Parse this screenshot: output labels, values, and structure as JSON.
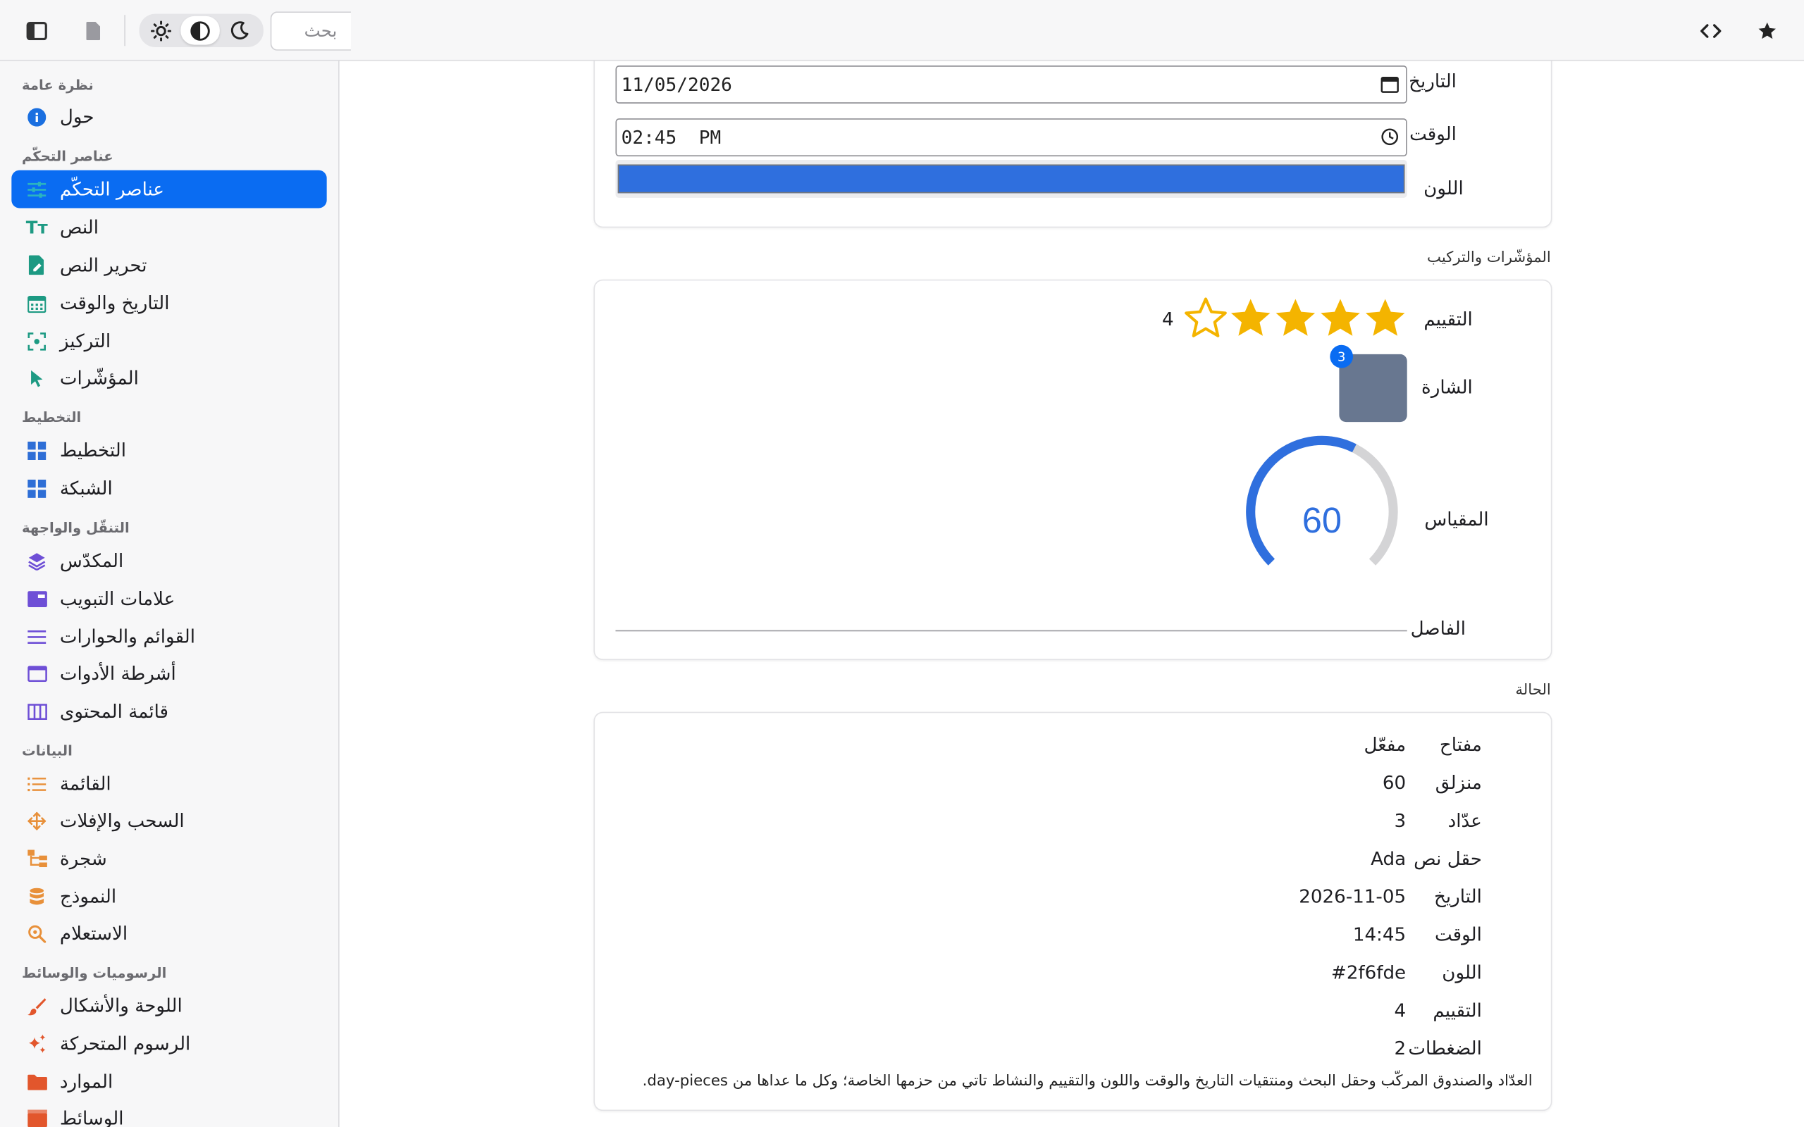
{
  "toolbar": {
    "search_placeholder": "بحث",
    "theme_options": [
      "light",
      "system",
      "dark"
    ],
    "selected_theme": "system"
  },
  "sidebar": {
    "sections": [
      {
        "title": "نظرة عامة",
        "items": [
          {
            "label": "حول",
            "icon": "info-icon"
          }
        ]
      },
      {
        "title": "عناصر التحكّم",
        "items": [
          {
            "label": "عناصر التحكّم",
            "icon": "sliders-icon",
            "active": true
          },
          {
            "label": "النص",
            "icon": "text-icon"
          },
          {
            "label": "تحرير النص",
            "icon": "edit-doc-icon"
          },
          {
            "label": "التاريخ والوقت",
            "icon": "calendar-icon"
          },
          {
            "label": "التركيز",
            "icon": "focus-icon"
          },
          {
            "label": "المؤشّرات",
            "icon": "cursor-icon"
          }
        ]
      },
      {
        "title": "التخطيط",
        "items": [
          {
            "label": "التخطيط",
            "icon": "layout-icon"
          },
          {
            "label": "الشبكة",
            "icon": "grid-icon"
          }
        ]
      },
      {
        "title": "التنقّل والواجهة",
        "items": [
          {
            "label": "المكدّس",
            "icon": "stack-icon"
          },
          {
            "label": "علامات التبويب",
            "icon": "tabs-icon"
          },
          {
            "label": "القوائم والحوارات",
            "icon": "menu-icon"
          },
          {
            "label": "أشرطة الأدوات",
            "icon": "toolbar-icon"
          },
          {
            "label": "قائمة المحتوى",
            "icon": "columns-icon"
          }
        ]
      },
      {
        "title": "البيانات",
        "items": [
          {
            "label": "القائمة",
            "icon": "list-icon"
          },
          {
            "label": "السحب والإفلات",
            "icon": "move-icon"
          },
          {
            "label": "شجرة",
            "icon": "tree-icon"
          },
          {
            "label": "النموذج",
            "icon": "database-icon"
          },
          {
            "label": "الاستعلام",
            "icon": "query-icon"
          }
        ]
      },
      {
        "title": "الرسوميات والوسائط",
        "items": [
          {
            "label": "اللوحة والأشكال",
            "icon": "brush-icon"
          },
          {
            "label": "الرسوم المتحركة",
            "icon": "sparkle-icon"
          },
          {
            "label": "الموارد",
            "icon": "folder-icon"
          },
          {
            "label": "الوسائط",
            "icon": "film-icon"
          }
        ]
      }
    ]
  },
  "inputs_card": {
    "date_label": "التاريخ",
    "date_value": "11/05/2026",
    "time_label": "الوقت",
    "time_value": "02:45  PM",
    "color_label": "اللون",
    "color_value": "#2f6fde"
  },
  "indicators": {
    "group_title": "المؤشّرات والتركيب",
    "rating_label": "التقييم",
    "rating_value": 4,
    "rating_max": 5,
    "rating_text": "4",
    "badge_label": "الشارة",
    "badge_count": "3",
    "gauge_label": "المقياس",
    "gauge_value": 60,
    "gauge_text": "60",
    "divider_label": "الفاصل"
  },
  "status": {
    "group_title": "الحالة",
    "rows": [
      {
        "label": "مفتاح",
        "value": "مفعّل"
      },
      {
        "label": "منزلق",
        "value": "60"
      },
      {
        "label": "عدّاد",
        "value": "3"
      },
      {
        "label": "حقل نص",
        "value": "Ada"
      },
      {
        "label": "التاريخ",
        "value": "2026-11-05"
      },
      {
        "label": "الوقت",
        "value": "14:45"
      },
      {
        "label": "اللون",
        "value": "#2f6fde"
      },
      {
        "label": "التقييم",
        "value": "4"
      },
      {
        "label": "الضغطات",
        "value": "2"
      }
    ],
    "note": "العدّاد والصندوق المركّب وحقل البحث ومنتقيات التاريخ والوقت واللون والتقييم والنشاط تاتي من حزمها الخاصة؛ وكل ما عداها من day-pieces."
  },
  "colors": {
    "accent": "#0a6cf2",
    "star": "#f4b400",
    "gauge": "#2f6fde",
    "gauge_track": "#d4d4d6"
  }
}
